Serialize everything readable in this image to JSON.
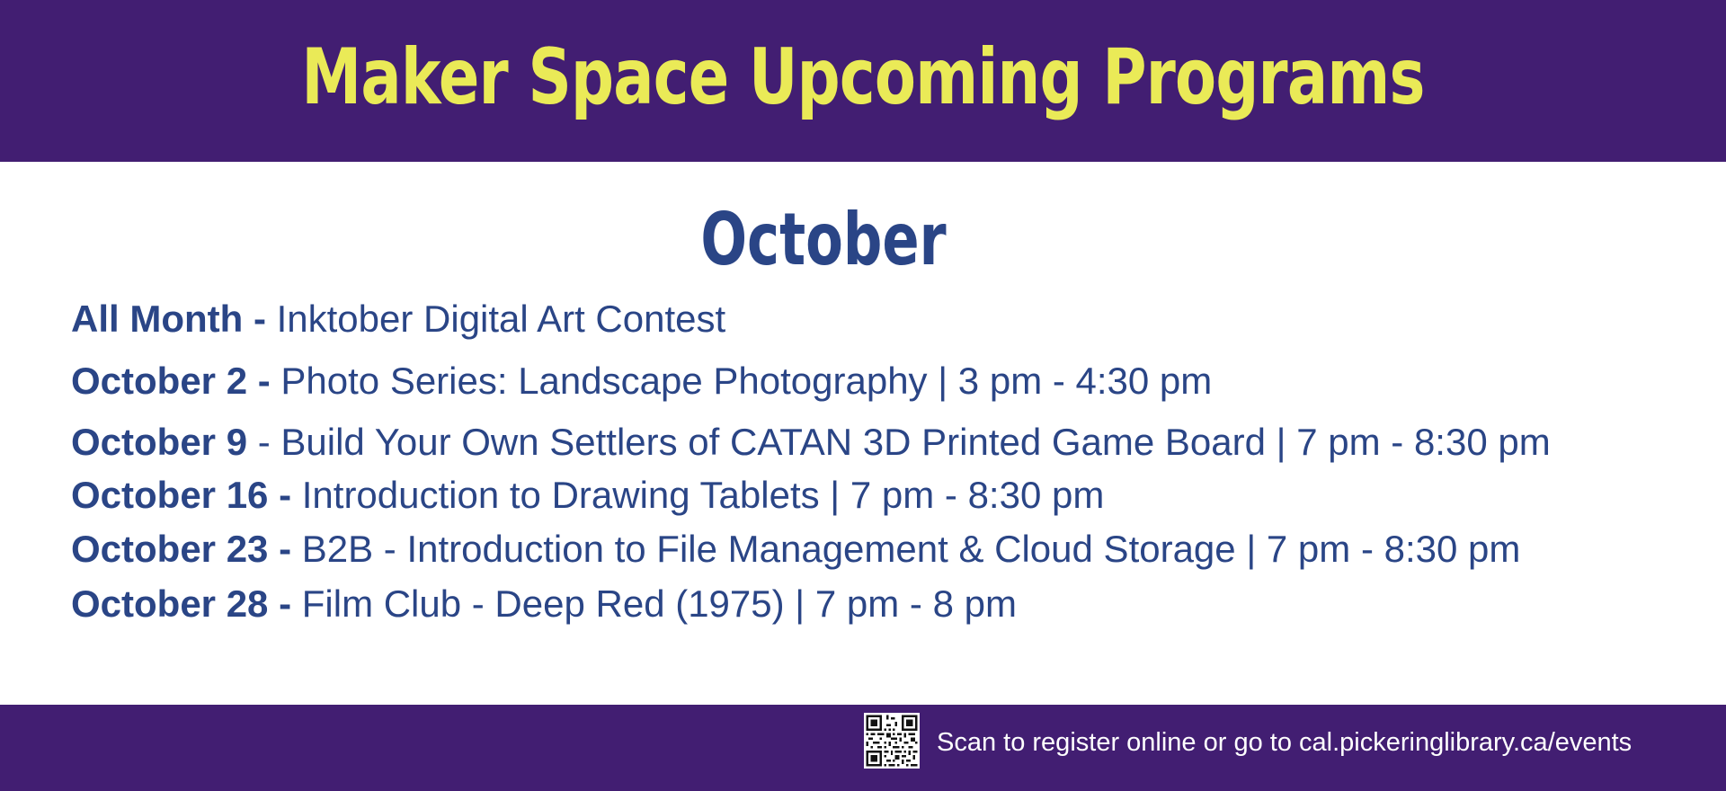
{
  "colors": {
    "band": "#421e72",
    "title": "#eaea57",
    "text": "#2a4586",
    "background": "#ffffff"
  },
  "header": {
    "title": "Maker Space Upcoming Programs"
  },
  "month": "October",
  "events": [
    {
      "date": "All Month -",
      "description": " Inktober Digital Art Contest"
    },
    {
      "date": "October 2 -",
      "description": " Photo Series: Landscape Photography | 3 pm - 4:30 pm"
    },
    {
      "date": "October 9",
      "description": " - Build Your Own Settlers of CATAN 3D Printed Game Board | 7 pm - 8:30 pm"
    },
    {
      "date": "October 16 -",
      "description": " Introduction to Drawing Tablets | 7 pm - 8:30 pm"
    },
    {
      "date": "October 23 -",
      "description": " B2B - Introduction to File Management & Cloud Storage | 7 pm - 8:30 pm"
    },
    {
      "date": "October 28 -",
      "description": " Film Club - Deep Red (1975) | 7 pm - 8 pm"
    }
  ],
  "footer": {
    "qr_icon": "qr-code-icon",
    "text": "Scan to register online or go to cal.pickeringlibrary.ca/events"
  }
}
